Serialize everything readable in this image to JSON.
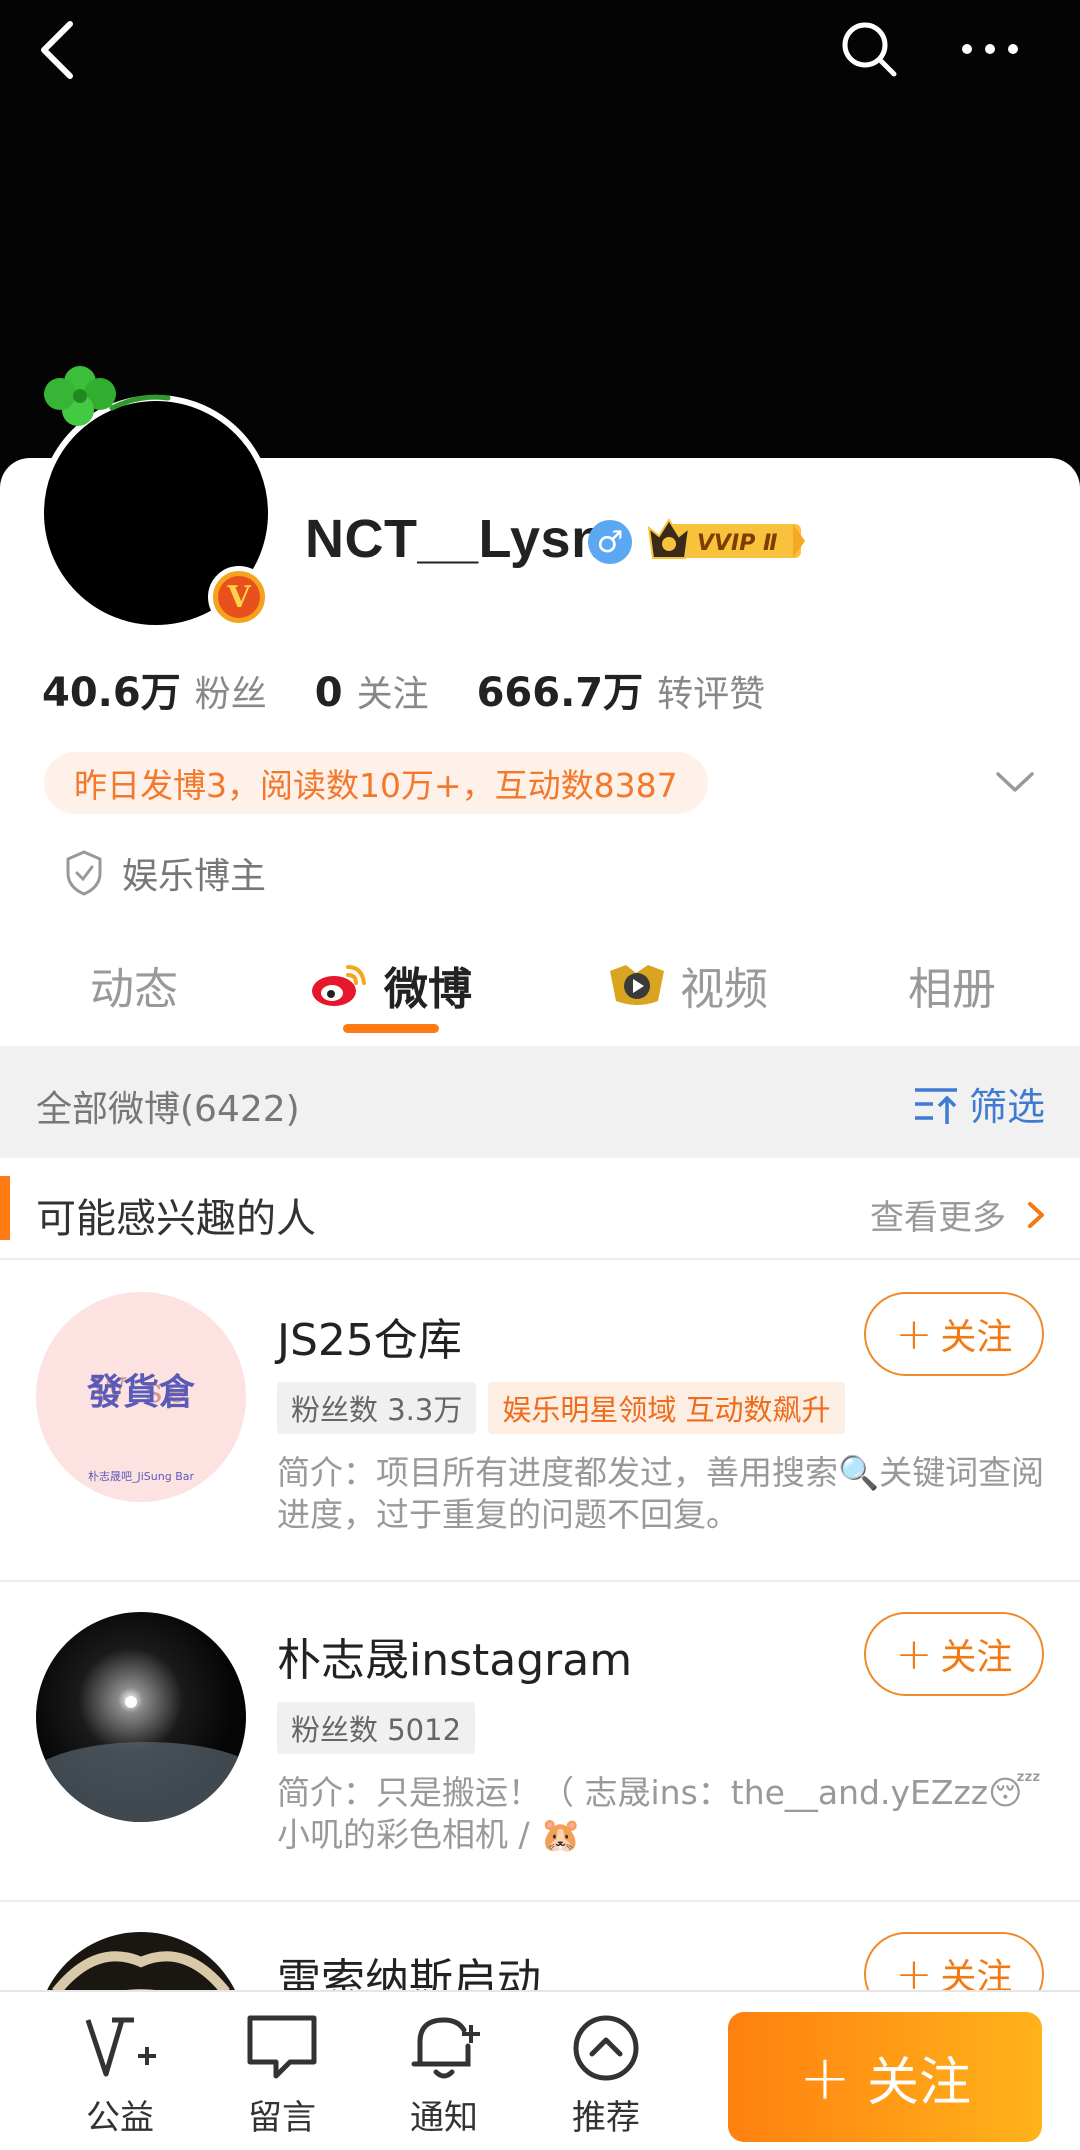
{
  "profile": {
    "username": "NCT__Lysn",
    "gender_symbol": "♂",
    "vip_label": "VVIP Ⅱ",
    "verified_mark": "V",
    "stats": [
      {
        "value": "40.6万",
        "label": "粉丝"
      },
      {
        "value": "0",
        "label": "关注"
      },
      {
        "value": "666.7万",
        "label": "转评赞"
      }
    ],
    "activity": "昨日发博3，阅读数10万+，互动数8387",
    "category": "娱乐博主"
  },
  "tabs": [
    {
      "label": "动态",
      "active": false
    },
    {
      "label": "微博",
      "active": true
    },
    {
      "label": "视频",
      "active": false
    },
    {
      "label": "相册",
      "active": false
    }
  ],
  "feed": {
    "all_label": "全部微博(6422)",
    "filter_label": "筛选"
  },
  "suggestions": {
    "title": "可能感兴趣的人",
    "more_label": "查看更多",
    "people": [
      {
        "name": "JS25仓库",
        "fans": "粉丝数 3.3万",
        "badge": "娱乐明星领域 互动数飙升",
        "intro": "简介：项目所有进度都发过，善用搜索🔍关键词查阅进度，过于重复的问题不回复。",
        "follow": "关注",
        "avatar_text": "發貨倉",
        "avatar_sub": "朴志晟吧_JiSung Bar"
      },
      {
        "name": "朴志晟instagram",
        "fans": "粉丝数 5012",
        "intro": "简介：只是搬运！（ 志晟ins：the__and.yEZzz😴 小叽的彩色相机 / 🐹",
        "follow": "关注"
      },
      {
        "name": "雷索纳斯启动",
        "follow": "关注"
      }
    ]
  },
  "bottom_bar": {
    "items": [
      {
        "label": "公益",
        "icon": "charity-icon"
      },
      {
        "label": "留言",
        "icon": "message-icon"
      },
      {
        "label": "通知",
        "icon": "notify-icon"
      },
      {
        "label": "推荐",
        "icon": "recommend-icon"
      }
    ],
    "follow_label": "关注"
  },
  "colors": {
    "accent": "#ff7a12",
    "link_blue": "#3f7bd0",
    "cover": "#040404"
  }
}
